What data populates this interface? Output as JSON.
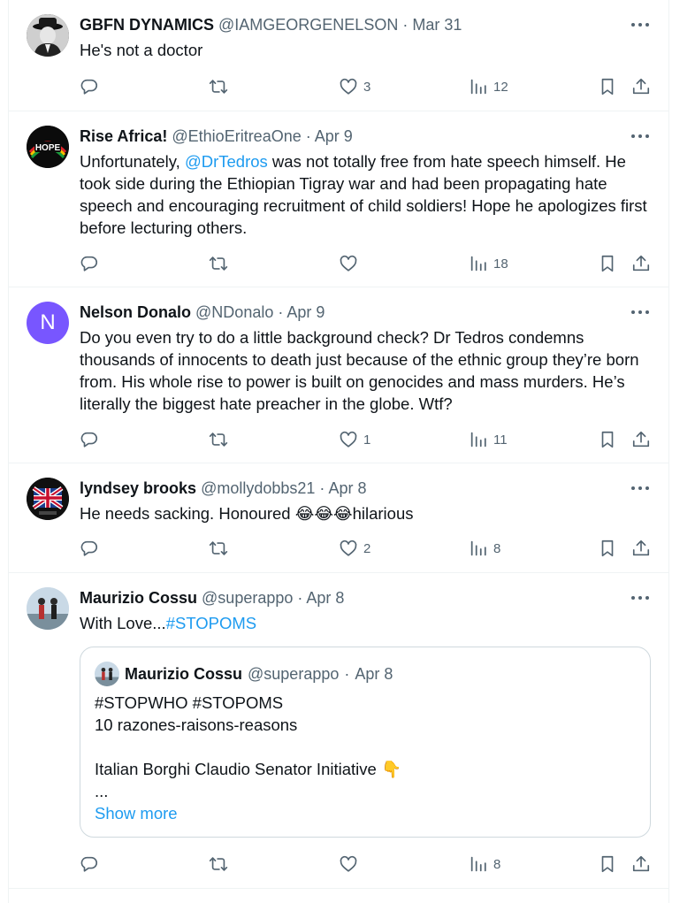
{
  "tweets": [
    {
      "name": "GBFN DYNAMICS",
      "handle": "@IAMGEORGENELSON",
      "date": "Mar 31",
      "text_before": "He's not a doctor",
      "mention": "",
      "text_after": "",
      "stats": {
        "replies": "",
        "retweets": "",
        "likes": "3",
        "views": "12"
      }
    },
    {
      "name": "Rise Africa!",
      "handle": "@EthioEritreaOne",
      "date": "Apr 9",
      "text_before": "Unfortunately, ",
      "mention": "@DrTedros",
      "text_after": " was not totally free from hate speech himself. He took side during the Ethiopian Tigray war and had been propagating hate speech and encouraging recruitment of child soldiers! Hope he apologizes first before lecturing others.",
      "avatar_label": "HOPE",
      "stats": {
        "replies": "",
        "retweets": "",
        "likes": "",
        "views": "18"
      }
    },
    {
      "name": "Nelson Donalo",
      "handle": "@NDonalo",
      "date": "Apr 9",
      "text_before": "Do you even try to do a little background check? Dr Tedros condemns thousands of innocents to death just because of the ethnic group they’re born from. His whole rise to power is built on genocides and mass murders. He’s literally the biggest hate preacher in the globe. Wtf?",
      "mention": "",
      "text_after": "",
      "avatar_letter": "N",
      "stats": {
        "replies": "",
        "retweets": "",
        "likes": "1",
        "views": "11"
      }
    },
    {
      "name": "lyndsey brooks",
      "handle": "@mollydobbs21",
      "date": "Apr 8",
      "text_before": "He needs sacking. Honoured ",
      "emoji": "😂😂😂",
      "text_after": "hilarious",
      "stats": {
        "replies": "",
        "retweets": "",
        "likes": "2",
        "views": "8"
      }
    },
    {
      "name": "Maurizio Cossu",
      "handle": "@superappo",
      "date": "Apr 8",
      "text_before": "With Love...",
      "hashtag": "#STOPOMS",
      "quote": {
        "name": "Maurizio Cossu",
        "handle": "@superappo",
        "date": "Apr 8",
        "text": "#STOPWHO #STOPOMS\n10 razones-raisons-reasons\n\nItalian Borghi Claudio Senator Initiative 👇\n...",
        "show_more": "Show more"
      },
      "stats": {
        "replies": "",
        "retweets": "",
        "likes": "",
        "views": "8"
      }
    }
  ],
  "separator": "·",
  "colors": {
    "text": "#0f1419",
    "secondary": "#536471",
    "link": "#1d9bf0",
    "border": "#eff3f4",
    "nelson_avatar": "#7856ff"
  },
  "icons": [
    "reply-icon",
    "retweet-icon",
    "like-icon",
    "views-icon",
    "bookmark-icon",
    "share-icon",
    "more-icon"
  ]
}
